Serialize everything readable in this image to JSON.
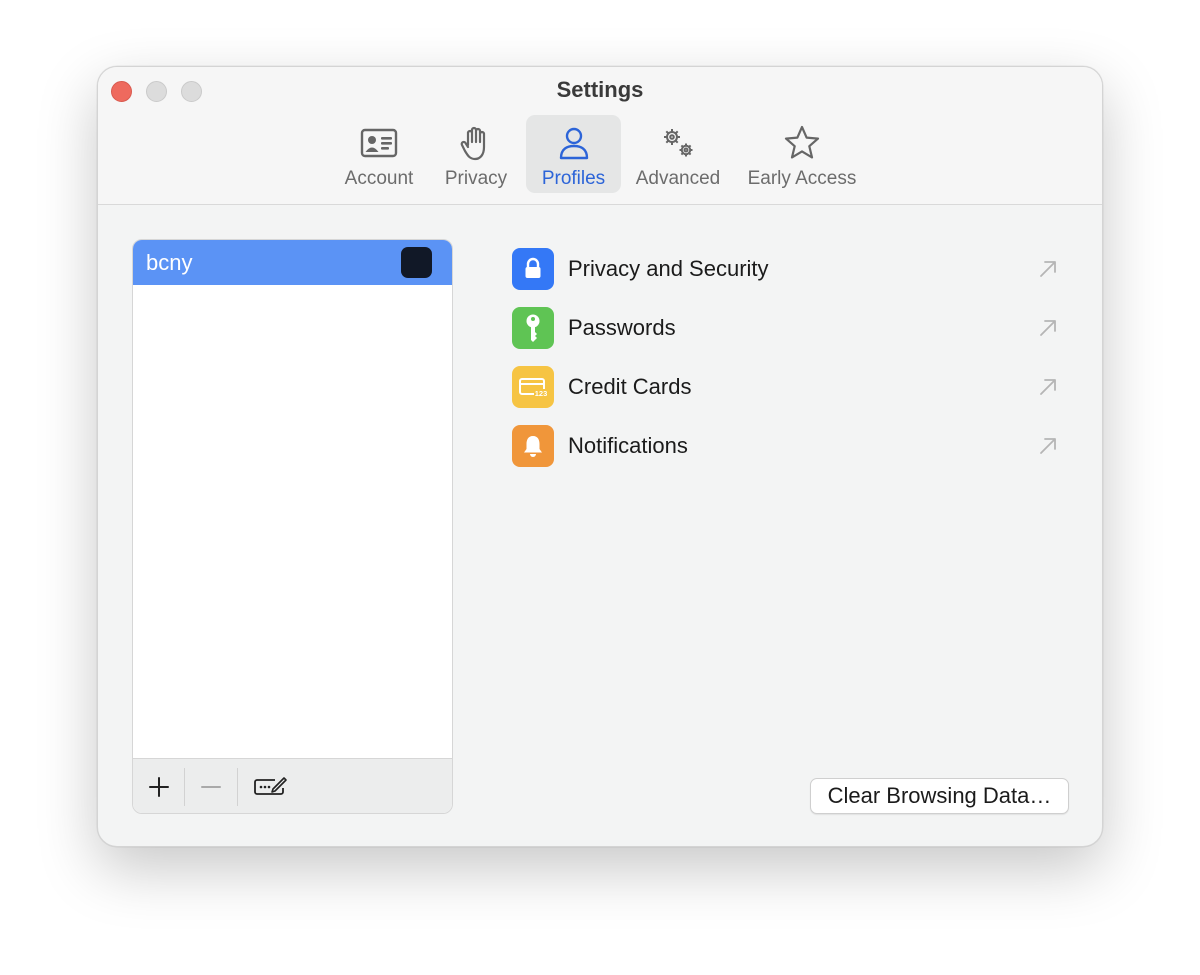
{
  "window": {
    "title": "Settings"
  },
  "tabs": [
    {
      "label": "Account",
      "icon": "account-card-icon",
      "selected": false
    },
    {
      "label": "Privacy",
      "icon": "hand-icon",
      "selected": false
    },
    {
      "label": "Profiles",
      "icon": "person-icon",
      "selected": true
    },
    {
      "label": "Advanced",
      "icon": "gears-icon",
      "selected": false
    },
    {
      "label": "Early Access",
      "icon": "star-icon",
      "selected": false
    }
  ],
  "profiles": {
    "items": [
      {
        "name": "bcny",
        "selected": true,
        "color": "#111827"
      }
    ],
    "toolbar": {
      "add_icon": "plus-icon",
      "remove_icon": "minus-icon",
      "rename_icon": "edit-field-icon"
    }
  },
  "settings": {
    "items": [
      {
        "label": "Privacy and Security",
        "icon": "lock-icon",
        "color": "#3478f6"
      },
      {
        "label": "Passwords",
        "icon": "key-icon",
        "color": "#5fc454"
      },
      {
        "label": "Credit Cards",
        "icon": "credit-card-icon",
        "color": "#f6c443"
      },
      {
        "label": "Notifications",
        "icon": "bell-icon",
        "color": "#f0963a"
      }
    ]
  },
  "clear_button_label": "Clear Browsing Data…",
  "colors": {
    "accent": "#2c64d8",
    "selection": "#5b93f5"
  }
}
